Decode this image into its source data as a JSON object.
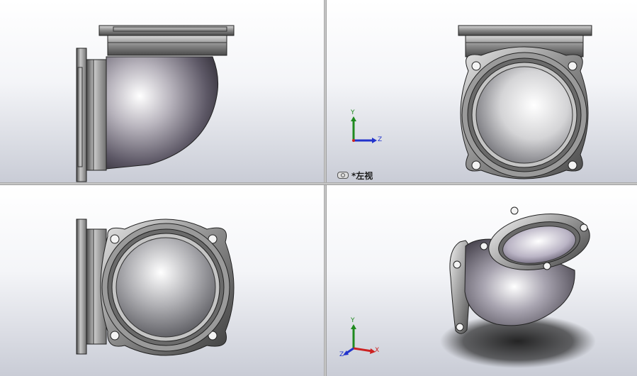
{
  "viewports": {
    "top_left": {
      "name": ""
    },
    "top_right": {
      "label": "*左视"
    },
    "bottom_left": {
      "name": ""
    },
    "bottom_right": {
      "name": ""
    }
  },
  "triad": {
    "axis_y": "Y",
    "axis_z": "Z",
    "axis_x": "X",
    "colors": {
      "x": "#cc2222",
      "y": "#1f8a1f",
      "z": "#2233cc"
    }
  },
  "icons": {
    "view_orientation": "view-orientation-icon"
  }
}
